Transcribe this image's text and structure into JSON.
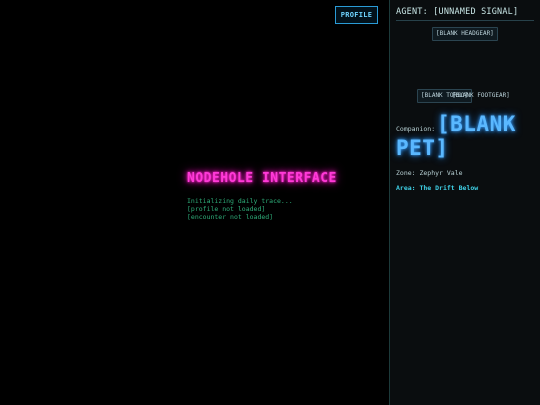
{
  "main": {
    "profile_button": "PROFILE",
    "title": "NODEHOLE INTERFACE",
    "log": [
      "Initializing daily trace...",
      "[profile not loaded]",
      "[encounter not loaded]"
    ]
  },
  "panel": {
    "agent": "AGENT: [UNNAMED SIGNAL]",
    "slots": {
      "headgear": "[BLANK HEADGEAR]",
      "torso": "[BLANK TORSO]",
      "footgear": "[BLANK FOOTGEAR]"
    },
    "companion_label": "Companion:",
    "pet": "[BLANK PET]",
    "zone": "Zone: Zephyr Vale",
    "area": "Area: The Drift Below"
  },
  "colors": {
    "title_neon": "#ff3ad8",
    "pet_neon": "#5ab8ff",
    "log_text": "#2fae7a",
    "area_text": "#3fd0e6",
    "profile_border": "#2a9bd6"
  }
}
